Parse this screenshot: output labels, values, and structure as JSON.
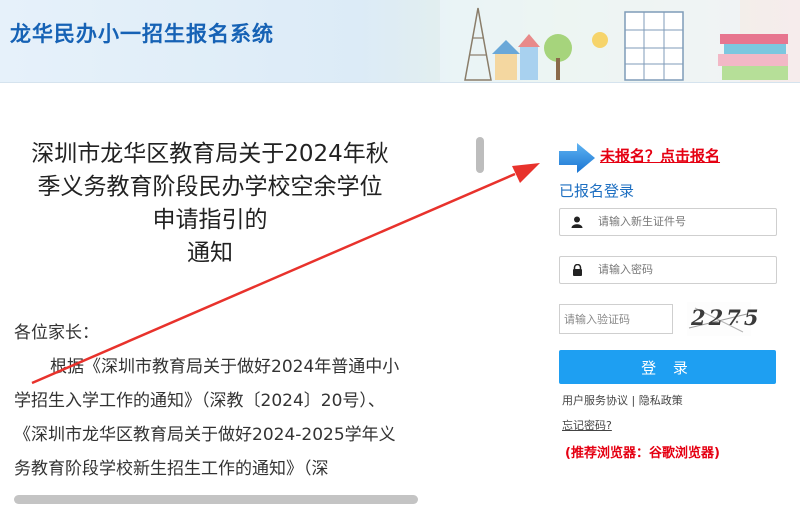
{
  "header": {
    "title": "龙华民办小一招生报名系统"
  },
  "notice": {
    "title_lines": [
      "深圳市龙华区教育局关于2024年秋",
      "季义务教育阶段民办学校空余学位",
      "申请指引的",
      "通知"
    ],
    "greeting": "各位家长：",
    "paragraph": "根据《深圳市教育局关于做好2024年普通中小学招生入学工作的通知》（深教〔2024〕20号）、《深圳市龙华区教育局关于做好2024-2025学年义务教育阶段学校新生招生工作的通知》（深"
  },
  "login": {
    "register_link": "未报名？点击报名",
    "heading": "已报名登录",
    "user_placeholder": "请输入新生证件号",
    "password_placeholder": "请输入密码",
    "captcha_placeholder": "请输入验证码",
    "captcha_text": "2275",
    "login_button": "登 录",
    "user_agreement": "用户服务协议",
    "separator": " | ",
    "privacy_policy": "隐私政策",
    "forgot_password": "忘记密码?",
    "browser_tip": "(推荐浏览器：谷歌浏览器)"
  },
  "icons": {
    "user": "user-icon",
    "lock": "lock-icon",
    "pointer_arrow": "arrow-right-icon"
  },
  "colors": {
    "brand_blue": "#1662b5",
    "button_blue": "#1e9ff2",
    "alert_red": "#e50012",
    "annotation_red": "#e8322c"
  }
}
